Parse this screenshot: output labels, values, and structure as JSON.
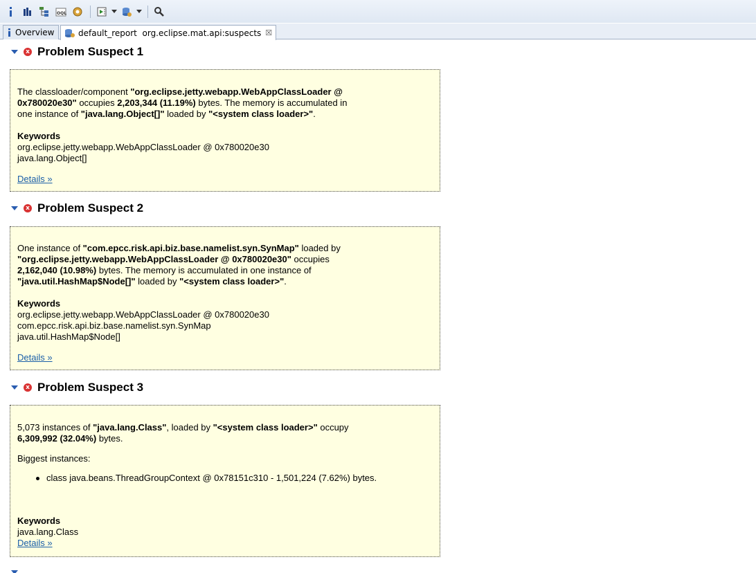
{
  "toolbar": {
    "icons": [
      "info-icon",
      "histogram-icon",
      "dominator-tree-icon",
      "oql-icon",
      "thread-overview-icon",
      "query-browser-icon",
      "heap-dump-icon",
      "search-icon"
    ]
  },
  "tabs": [
    {
      "label": "Overview",
      "icon": "info-icon"
    },
    {
      "label": "default_report  org.eclipse.mat.api:suspects",
      "icon": "report-icon",
      "close": "☒"
    }
  ],
  "suspects": [
    {
      "title": "Problem Suspect 1",
      "desc": {
        "t1": "The classloader/component ",
        "b1": "\"org.eclipse.jetty.webapp.WebAppClassLoader @",
        "b2": "0x780020e30\"",
        "t2": " occupies ",
        "b3": "2,203,344 (11.19%)",
        "t3": " bytes. The memory is accumulated in",
        "t4": "one instance of ",
        "b4": "\"java.lang.Object[]\"",
        "t5": " loaded by ",
        "b5": "\"<system class loader>\"",
        "t6": "."
      },
      "keywords_title": "Keywords",
      "keywords": [
        "org.eclipse.jetty.webapp.WebAppClassLoader @ 0x780020e30",
        "java.lang.Object[]"
      ],
      "details": "Details »"
    },
    {
      "title": "Problem Suspect 2",
      "desc": {
        "t1": "One instance of ",
        "b1": "\"com.epcc.risk.api.biz.base.namelist.syn.SynMap\"",
        "t2": " loaded by",
        "b2": "\"org.eclipse.jetty.webapp.WebAppClassLoader @ 0x780020e30\"",
        "t3": " occupies",
        "b3": "2,162,040 (10.98%)",
        "t4": " bytes. The memory is accumulated in one instance of",
        "b4": "\"java.util.HashMap$Node[]\"",
        "t5": " loaded by ",
        "b5": "\"<system class loader>\"",
        "t6": "."
      },
      "keywords_title": "Keywords",
      "keywords": [
        "org.eclipse.jetty.webapp.WebAppClassLoader @ 0x780020e30",
        "com.epcc.risk.api.biz.base.namelist.syn.SynMap",
        "java.util.HashMap$Node[]"
      ],
      "details": "Details »"
    },
    {
      "title": "Problem Suspect 3",
      "desc": {
        "t1": "5,073 instances of ",
        "b1": "\"java.lang.Class\"",
        "t2": ", loaded by ",
        "b2": "\"<system class loader>\"",
        "t3": " occupy",
        "b3": "6,309,992 (32.04%)",
        "t4": " bytes."
      },
      "biggest_label": "Biggest instances:",
      "biggest": [
        "class java.beans.ThreadGroupContext @ 0x78151c310 - 1,501,224 (7.62%) bytes."
      ],
      "keywords_title": "Keywords",
      "keywords": [
        "java.lang.Class"
      ],
      "details": "Details »"
    }
  ],
  "colors": {
    "box_bg": "#ffffe1",
    "error": "#d93232",
    "link": "#1a5ea8"
  }
}
